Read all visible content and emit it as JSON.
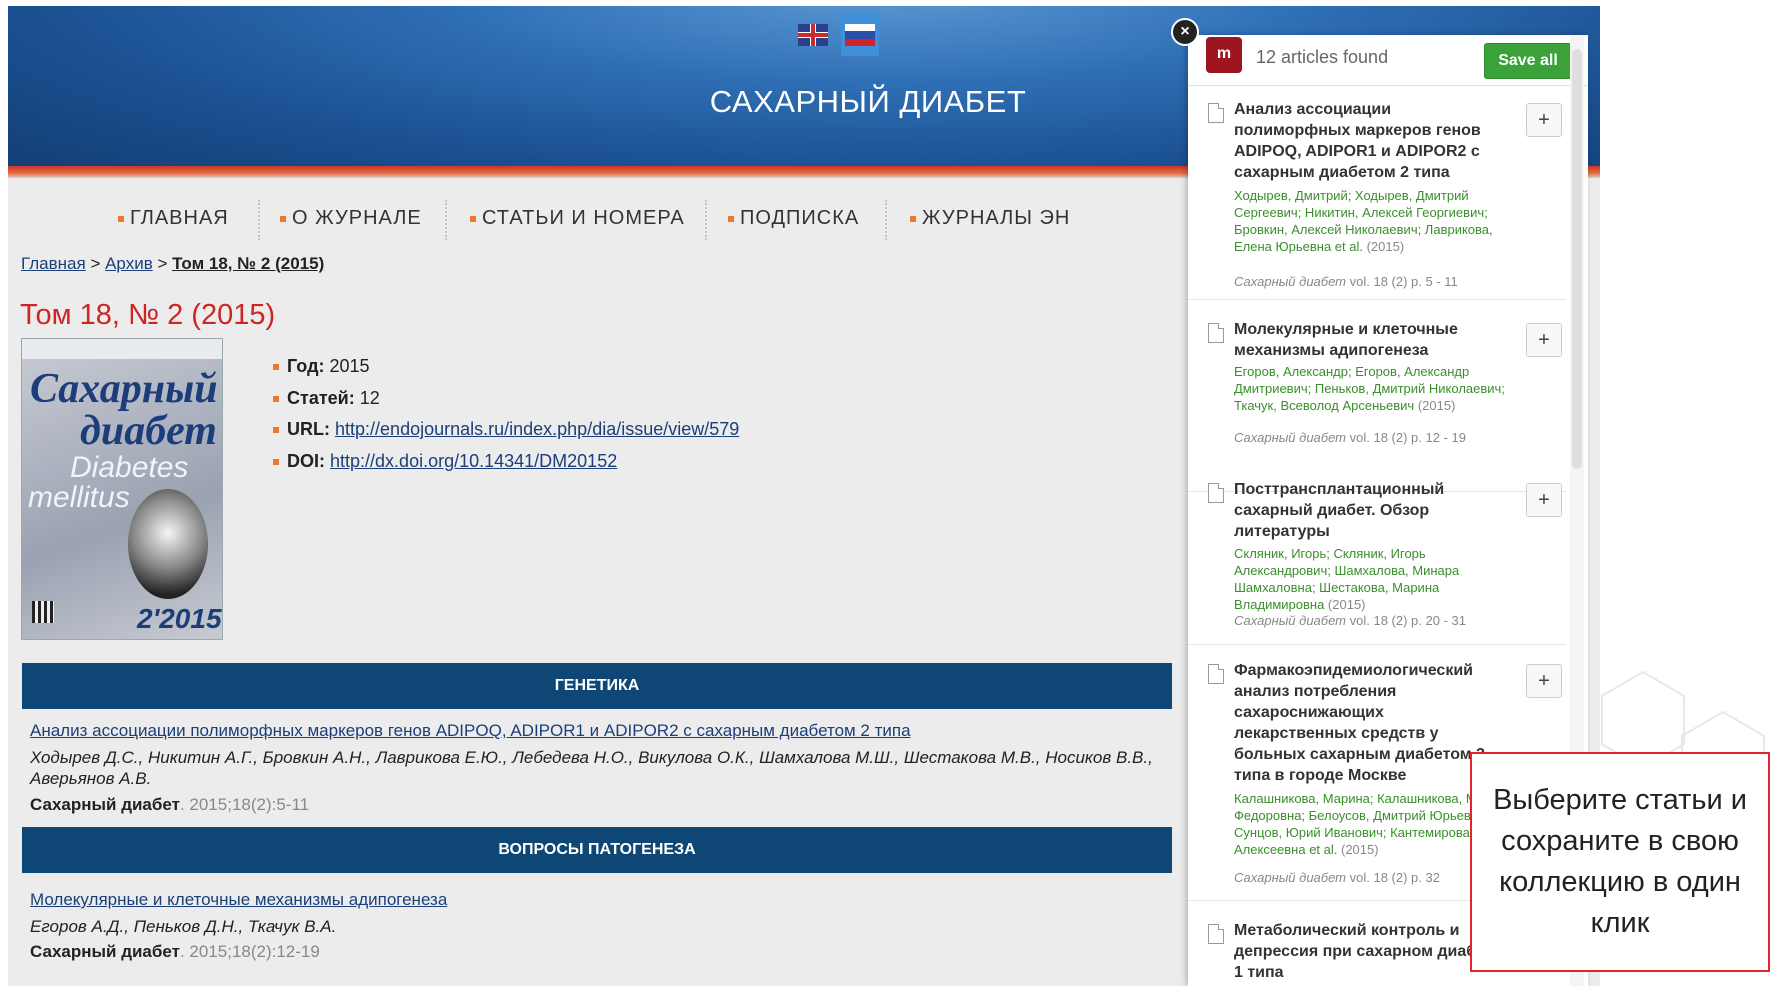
{
  "site": {
    "title": "САХАРНЫЙ ДИАБЕТ",
    "nav": [
      "ГЛАВНАЯ",
      "О ЖУРНАЛЕ",
      "СТАТЬИ И НОМЕРА",
      "ПОДПИСКА",
      "ЖУРНАЛЫ ЭН"
    ],
    "breadcrumb": {
      "home": "Главная",
      "sep1": " > ",
      "archive": "Архив",
      "sep2": " > ",
      "current": "Том 18, № 2 (2015)"
    },
    "issue_title": "Том 18, № 2 (2015)",
    "cover": {
      "t1": "Сахарный",
      "t2": "диабет",
      "t3": "Diabetes",
      "t4": "mellitus",
      "t5": "2'2015"
    },
    "meta": {
      "year_label": "Год:",
      "year": "2015",
      "count_label": "Статей:",
      "count": "12",
      "url_label": "URL:",
      "url": "http://endojournals.ru/index.php/dia/issue/view/579",
      "doi_label": "DOI:",
      "doi": "http://dx.doi.org/10.14341/DM20152"
    },
    "sections": [
      {
        "heading": "ГЕНЕТИКА",
        "article": {
          "title": "Анализ ассоциации полиморфных маркеров генов ADIPOQ, ADIPOR1 и ADIPOR2 с сахарным диабетом 2 типа",
          "authors": "Ходырев Д.С., Никитин А.Г., Бровкин А.Н., Лаврикова Е.Ю., Лебедева Н.О., Викулова О.К., Шамхалова М.Ш., Шестакова М.В., Носиков В.В., Аверьянов А.В.",
          "journal": "Сахарный диабет",
          "ref": ". 2015;18(2):5-11"
        }
      },
      {
        "heading": "ВОПРОСЫ ПАТОГЕНЕЗА",
        "article": {
          "title": "Молекулярные и клеточные механизмы адипогенеза",
          "authors": "Егоров А.Д., Пеньков Д.Н., Ткачук В.А.",
          "journal": "Сахарный диабет",
          "ref": ". 2015;18(2):12-19"
        }
      }
    ]
  },
  "panel": {
    "logo": "m",
    "found": "12 articles found",
    "save_all": "Save all",
    "close": "×",
    "add": "+",
    "items": [
      {
        "title": "Анализ ассоциации полиморфных маркеров генов ADIPOQ, ADIPOR1 и ADIPOR2 с сахарным диабетом 2 типа",
        "authors": "Ходырев, Дмитрий; Ходырев, Дмитрий Сергеевич; Никитин, Алексей Георгиевич; Бровкин, Алексей Николаевич; Лаврикова, Елена Юрьевна et al.",
        "year": " (2015)",
        "journal": "Сахарный диабет",
        "ref": " vol. 18 (2) p. 5 - 11"
      },
      {
        "title": "Молекулярные и клеточные механизмы адипогенеза",
        "authors": "Егоров, Александр; Егоров, Александр Дмитриевич; Пеньков, Дмитрий Николаевич; Ткачук, Всеволод Арсеньевич",
        "year": " (2015)",
        "journal": "Сахарный диабет",
        "ref": " vol. 18 (2) p. 12 - 19"
      },
      {
        "title": "Посттрансплантационный сахарный диабет. Обзор литературы",
        "authors": "Скляник, Игорь; Скляник, Игорь Александрович; Шамхалова, Минара Шамхаловна; Шестакова, Марина Владимировна",
        "year": " (2015)",
        "journal": "Сахарный диабет",
        "ref": " vol. 18 (2) p. 20 - 31"
      },
      {
        "title": "Фармакоэпидемиологический анализ потребления сахароснижающих лекарственных средств у больных сахарным диабетом 2 типа в городе Москве",
        "authors": "Калашникова, Марина; Калашникова, Марина Федоровна; Белоусов, Дмитрий Юрьевич; Сунцов, Юрий Иванович; Кантемирова, Мария Алексеевна et al.",
        "year": " (2015)",
        "journal": "Сахарный диабет",
        "ref": " vol. 18 (2) p. 32"
      },
      {
        "title": "Метаболический контроль и депрессия при сахарном диабете 1 типа",
        "authors": "",
        "year": "",
        "journal": "",
        "ref": ""
      }
    ]
  },
  "callout": "Выберите статьи и сохраните в свою коллекцию в один клик",
  "colors": {
    "accent_red": "#e3242b",
    "brand_blue": "#0e4676",
    "mendeley_red": "#9d1520",
    "save_green": "#3ba23a"
  }
}
